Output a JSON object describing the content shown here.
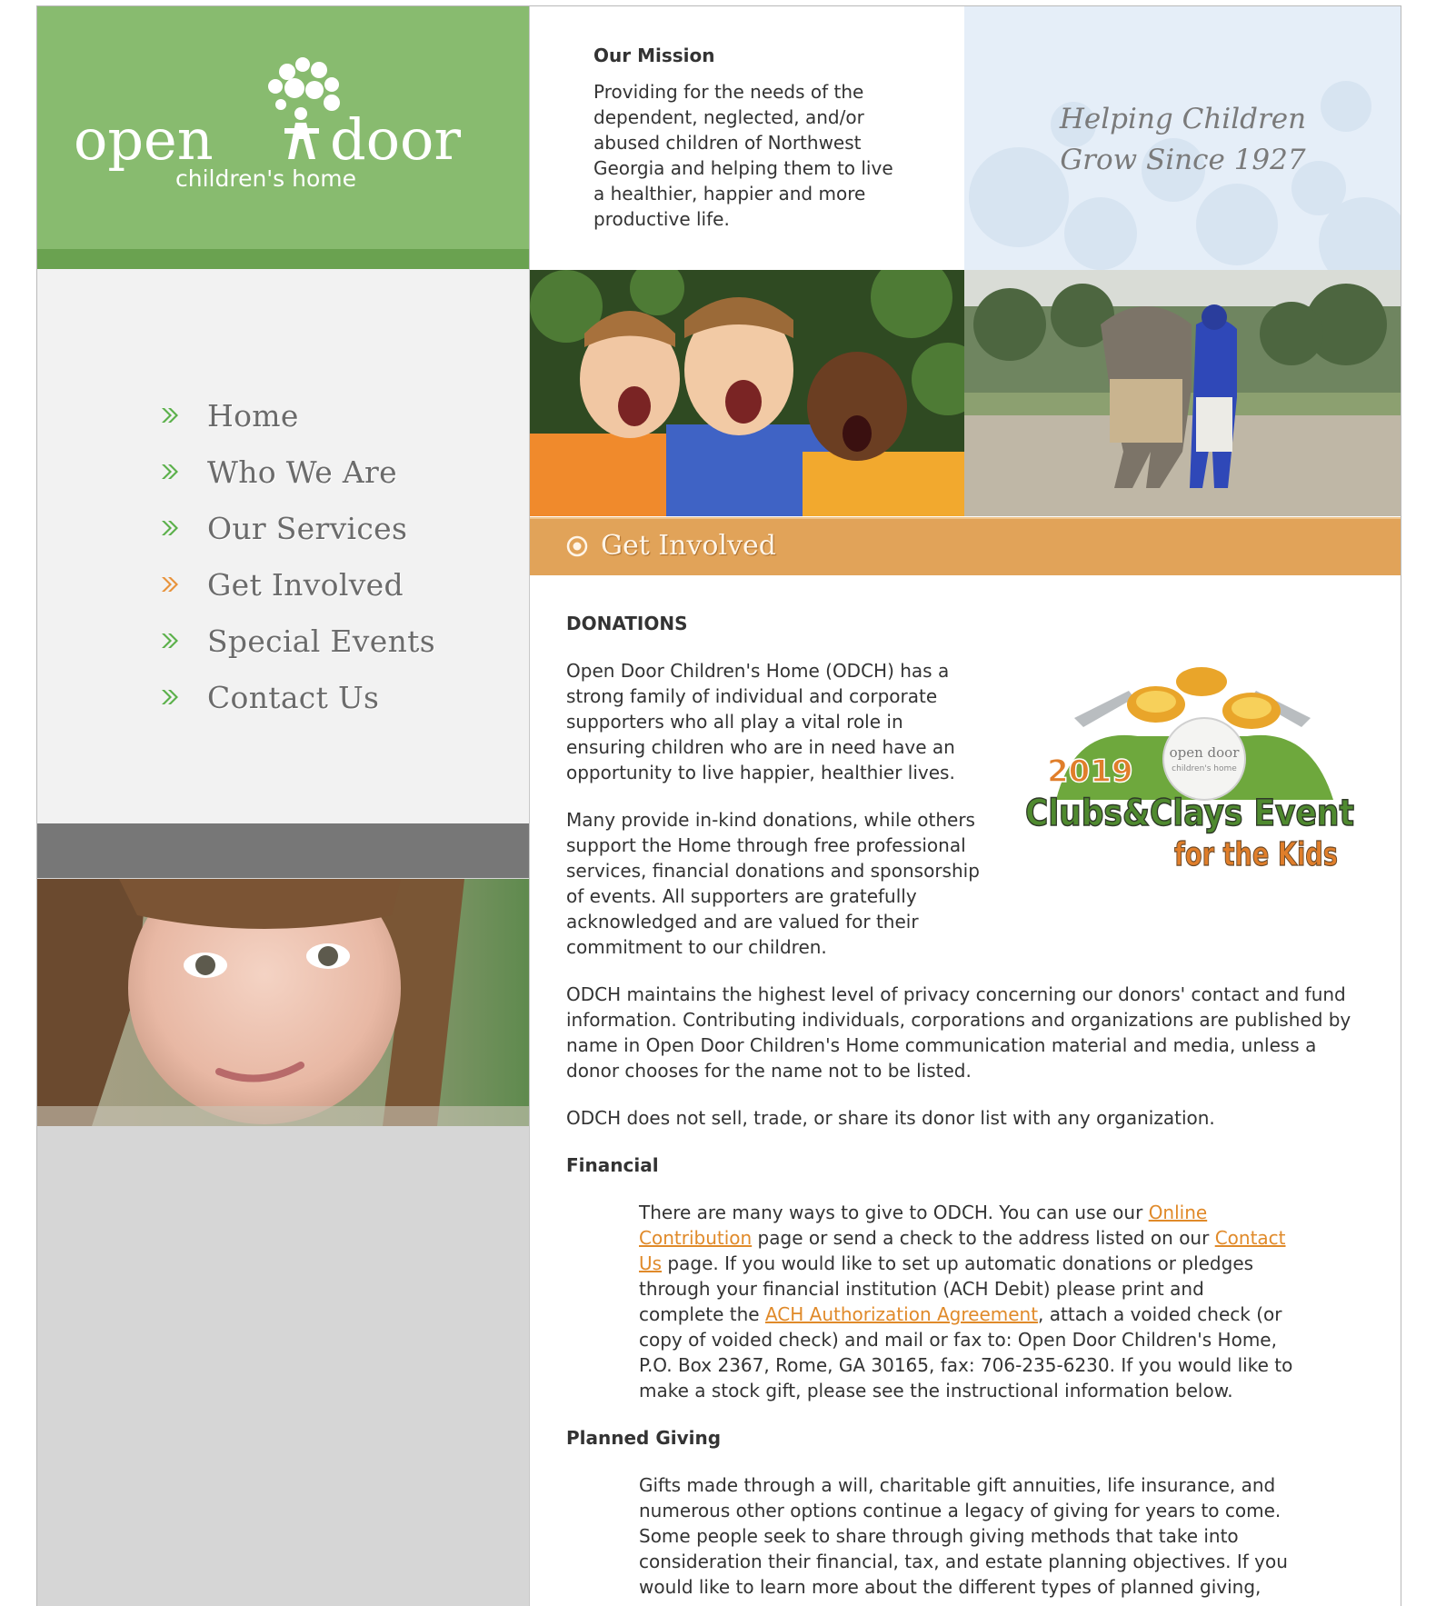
{
  "logo": {
    "line1_left": "open",
    "line1_right": "door",
    "line2": "children's home"
  },
  "nav": {
    "items": [
      {
        "label": "Home",
        "active": false
      },
      {
        "label": "Who We Are",
        "active": false
      },
      {
        "label": "Our Services",
        "active": false
      },
      {
        "label": "Get Involved",
        "active": true
      },
      {
        "label": "Special Events",
        "active": false
      },
      {
        "label": "Contact Us",
        "active": false
      }
    ]
  },
  "mission": {
    "title": "Our Mission",
    "text": "Providing for the needs of the dependent, neglected, and/or abused children of Northwest Georgia and helping them to live a healthier, happier and more productive life."
  },
  "tagline": {
    "line1": "Helping Children",
    "line2": "Grow Since 1927"
  },
  "section": {
    "title": "Get Involved"
  },
  "donations": {
    "heading": "DONATIONS",
    "p1": "Open Door Children's Home (ODCH) has a strong family of individual and corporate supporters who all play a vital role in ensuring children who are in need have an opportunity to live happier, healthier lives.",
    "p2": "Many provide in-kind donations, while others support the Home through free professional services, financial donations and sponsorship of events. All supporters are gratefully acknowledged and are valued for their commitment to our children.",
    "p3": "ODCH maintains the highest level of privacy concerning our donors' contact and fund information. Contributing individuals, corporations and organizations are published by name in Open Door Children's Home communication material and media, unless a donor chooses for the name not to be listed.",
    "p4": "ODCH does not sell, trade, or share its donor list with any organization."
  },
  "event_logo": {
    "year": "2019",
    "line1": "Clubs&Clays Event",
    "line2": "for the Kids",
    "ball_text1": "open door",
    "ball_text2": "children's home"
  },
  "financial": {
    "heading": "Financial",
    "t1": "There are many ways to give to ODCH. You can use our ",
    "link1": "Online Contribution",
    "t2": " page or send a check to the address listed on our ",
    "link2": "Contact Us",
    "t3": " page. If you would like to set up automatic donations or pledges through your financial institution (ACH Debit) please print and complete the ",
    "link3": "ACH Authorization Agreement",
    "t4": ", attach a voided check (or copy of voided check) and mail or fax to: Open Door Children's Home, P.O. Box 2367, Rome, GA 30165, fax: 706-235-6230. If you would like to make a stock gift, please see the instructional information below."
  },
  "planned": {
    "heading": "Planned Giving",
    "text": "Gifts made through a will, charitable gift annuities, life insurance, and numerous other options continue a legacy of giving for years to come. Some people seek to share through giving methods that take into consideration their financial, tax, and estate planning objectives. If you would like to learn more about the different types of planned giving,"
  },
  "colors": {
    "brand_green": "#88bb6f",
    "accent_orange": "#e1a359",
    "link_orange": "#e08a2a"
  }
}
